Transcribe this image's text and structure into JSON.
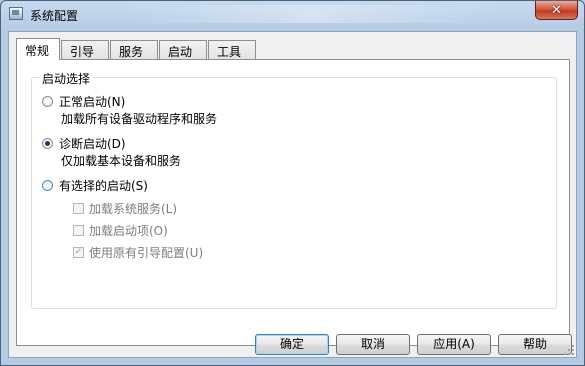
{
  "window": {
    "title": "系统配置",
    "close_glyph": "✕"
  },
  "tabs": [
    {
      "label": "常规"
    },
    {
      "label": "引导"
    },
    {
      "label": "服务"
    },
    {
      "label": "启动"
    },
    {
      "label": "工具"
    }
  ],
  "startup_group": {
    "title": "启动选择",
    "normal": {
      "label": "正常启动(N)",
      "desc": "加载所有设备驱动程序和服务",
      "selected": false
    },
    "diagnostic": {
      "label": "诊断启动(D)",
      "desc": "仅加载基本设备和服务",
      "selected": true
    },
    "selective": {
      "label": "有选择的启动(S)",
      "selected": false
    },
    "options": [
      {
        "label": "加载系统服务(L)",
        "checked": false,
        "enabled": false
      },
      {
        "label": "加载启动项(O)",
        "checked": false,
        "enabled": false
      },
      {
        "label": "使用原有引导配置(U)",
        "checked": true,
        "enabled": false
      }
    ]
  },
  "buttons": {
    "ok": "确定",
    "cancel": "取消",
    "apply": "应用(A)",
    "help": "帮助"
  },
  "icons": {
    "app": "system-config-icon",
    "close": "close-icon",
    "check": "✓"
  }
}
